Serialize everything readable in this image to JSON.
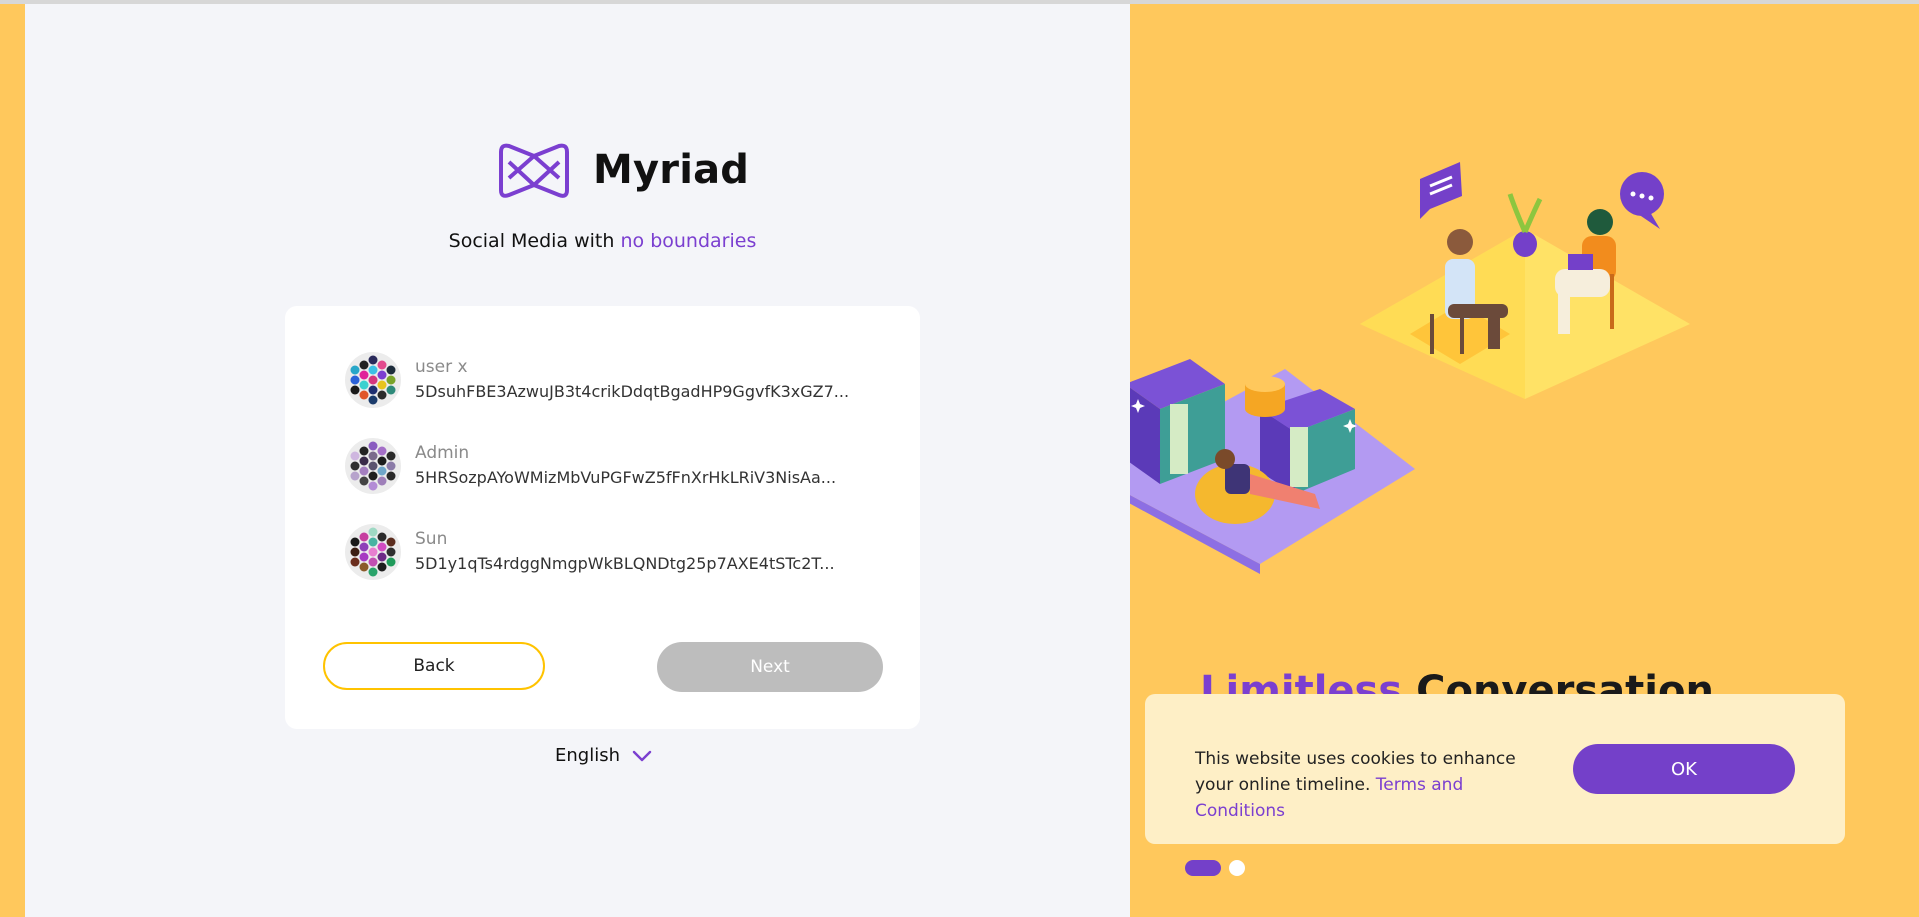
{
  "brand": {
    "name": "Myriad",
    "logo_icon": "myriad-logo-icon"
  },
  "tagline": {
    "prefix": "Social Media with",
    "highlight": "no boundaries"
  },
  "accounts": [
    {
      "name": "user x",
      "address": "5DsuhFBE3AzwuJB3t4crikDdqtBgadHP9GgvfK3xGZ7..."
    },
    {
      "name": "Admin",
      "address": "5HRSozpAYoWMizMbVuPGFwZ5fFnXrHkLRiV3NisAa..."
    },
    {
      "name": "Sun",
      "address": "5D1y1qTs4rdggNmgpWkBLQNDtg25p7AXE4tSTc2T..."
    }
  ],
  "buttons": {
    "back": "Back",
    "next": "Next"
  },
  "language": {
    "selected": "English"
  },
  "promo": {
    "headline_purple": "Limitless",
    "headline_dark": "Conversation"
  },
  "cookie": {
    "text": "This website uses cookies to enhance your online timeline.",
    "link": "Terms and Conditions",
    "ok": "OK"
  },
  "colors": {
    "accent": "#7440C9",
    "brand_purple": "#7B3FD0",
    "yellow": "#FFC85C",
    "back_border": "#FFC300",
    "next_disabled": "#BDBDBD"
  }
}
